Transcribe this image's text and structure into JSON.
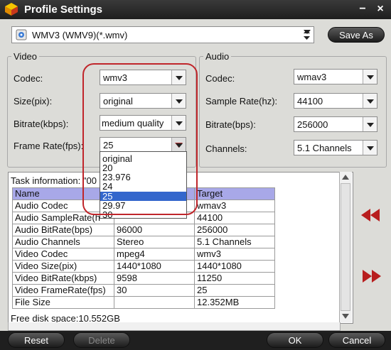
{
  "window": {
    "title": "Profile Settings",
    "minimize_glyph": "−",
    "close_glyph": "×",
    "app_icon": "app-logo-icon"
  },
  "profile": {
    "value": "WMV3 (WMV9)(*.wmv)",
    "icon": "wmv-format-icon",
    "save_as_label": "Save As"
  },
  "video": {
    "group_label": "Video",
    "codec": {
      "label": "Codec:",
      "value": "wmv3"
    },
    "size": {
      "label": "Size(pix):",
      "value": "original"
    },
    "bitrate": {
      "label": "Bitrate(kbps):",
      "value": "medium quality"
    },
    "frame_rate": {
      "label": "Frame Rate(fps):",
      "value": "25",
      "options": [
        "original",
        "20",
        "23.976",
        "24",
        "25",
        "29.97",
        "30"
      ],
      "selected_index": 4
    }
  },
  "audio": {
    "group_label": "Audio",
    "codec": {
      "label": "Codec:",
      "value": "wmav3"
    },
    "sample_rate": {
      "label": "Sample Rate(hz):",
      "value": "44100"
    },
    "bitrate": {
      "label": "Bitrate(bps):",
      "value": "256000"
    },
    "channels": {
      "label": "Channels:",
      "value": "5.1 Channels"
    }
  },
  "task": {
    "info_label": "Task information: \"00",
    "columns": [
      "Name",
      "",
      "Target"
    ],
    "rows": [
      [
        "Audio Codec",
        "",
        "wmav3"
      ],
      [
        "Audio SampleRate(h",
        "",
        "44100"
      ],
      [
        "Audio BitRate(bps)",
        "96000",
        "256000"
      ],
      [
        "Audio Channels",
        "Stereo",
        "5.1 Channels"
      ],
      [
        "Video Codec",
        "mpeg4",
        "wmv3"
      ],
      [
        "Video Size(pix)",
        "1440*1080",
        "1440*1080"
      ],
      [
        "Video BitRate(kbps)",
        "9598",
        "11250"
      ],
      [
        "Video FrameRate(fps)",
        "30",
        "25"
      ],
      [
        "File Size",
        "",
        "12.352MB"
      ]
    ],
    "free_space": "Free disk space:10.552GB"
  },
  "colors": {
    "accent_red": "#c0262b",
    "selection_blue": "#3366cc",
    "header_row": "#a8a8e8"
  },
  "buttons": {
    "reset": "Reset",
    "delete": "Delete",
    "ok": "OK",
    "cancel": "Cancel"
  },
  "nav": {
    "prev_icon": "rewind-icon",
    "next_icon": "fast-forward-icon"
  }
}
